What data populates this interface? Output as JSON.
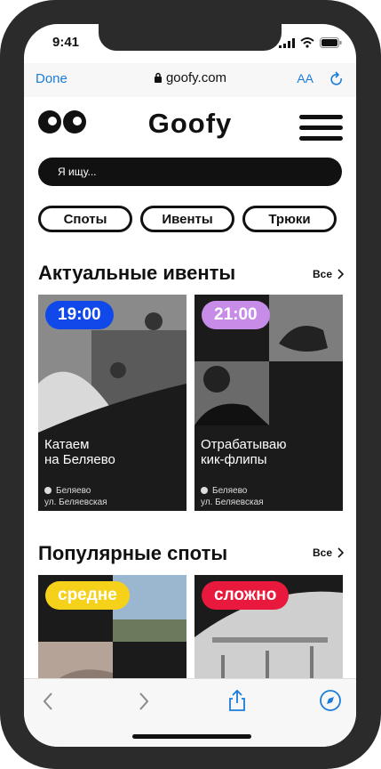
{
  "status": {
    "time": "9:41"
  },
  "browser": {
    "done_label": "Done",
    "url": "goofy.com",
    "aa_label": "AA"
  },
  "header": {
    "brand": "Goofy"
  },
  "search": {
    "placeholder": "Я ищу..."
  },
  "chips": [
    {
      "label": "Споты"
    },
    {
      "label": "Ивенты"
    },
    {
      "label": "Трюки"
    }
  ],
  "events": {
    "title": "Актуальные ивенты",
    "all_label": "Все",
    "cards": [
      {
        "time": "19:00",
        "badge_color": "#1148e9",
        "title_line1": "Катаем",
        "title_line2": "на Беляево",
        "metro": "Беляево",
        "address": "ул. Беляевская"
      },
      {
        "time": "21:00",
        "badge_color": "#c78ce7",
        "title_line1": "Отрабатываю",
        "title_line2": "кик-флипы",
        "metro": "Беляево",
        "address": "ул. Беляевская"
      }
    ]
  },
  "spots": {
    "title": "Популярные споты",
    "all_label": "Все",
    "cards": [
      {
        "level": "средне",
        "badge_color": "#f6d11a",
        "text_color": "#fff"
      },
      {
        "level": "сложно",
        "badge_color": "#e8193c",
        "text_color": "#fff"
      }
    ]
  }
}
